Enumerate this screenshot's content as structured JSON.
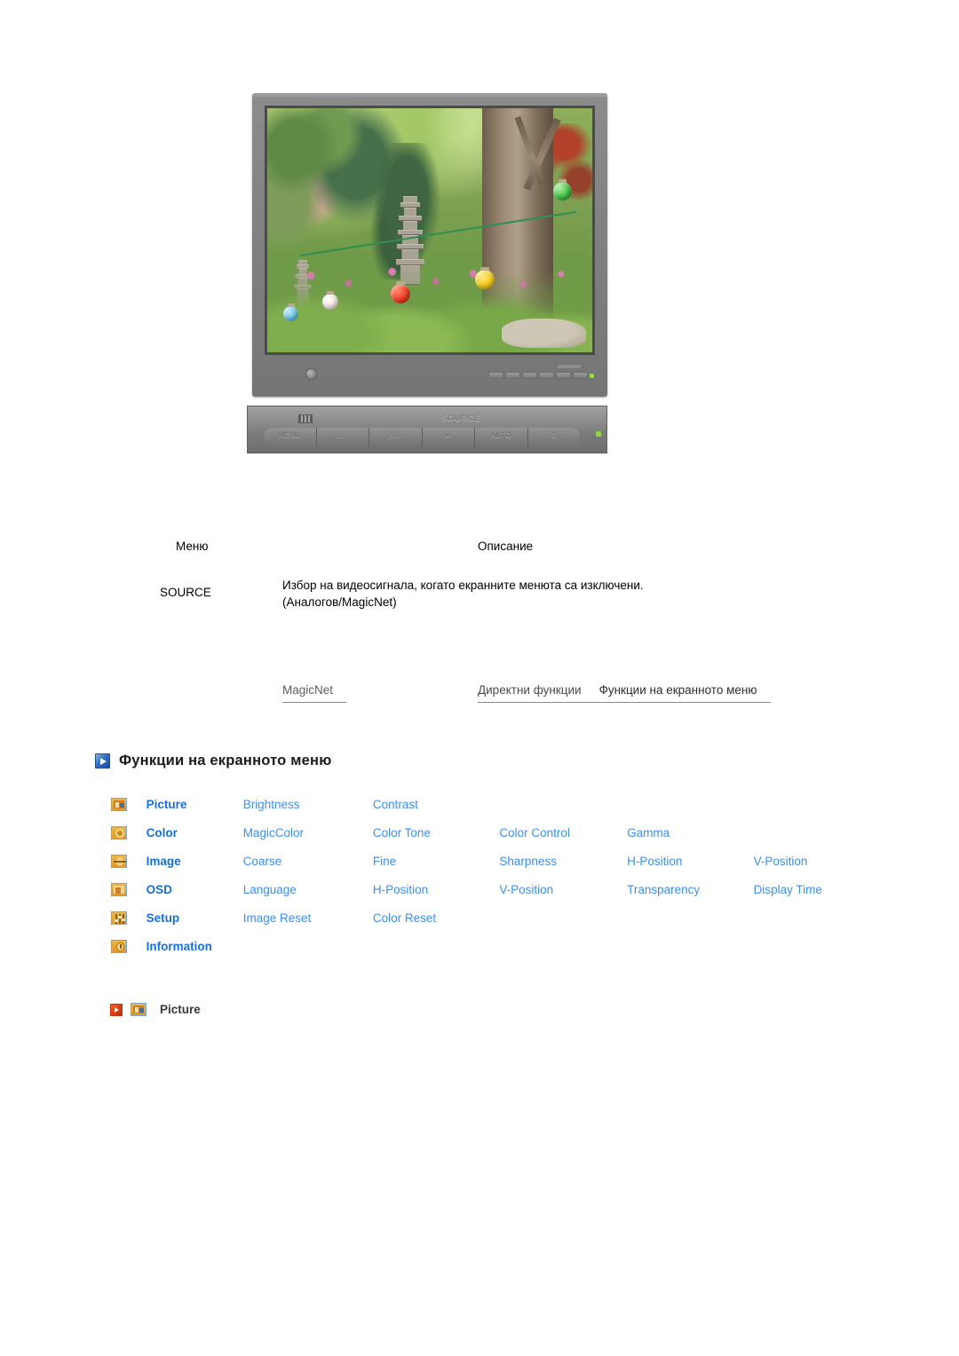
{
  "product_illustration": {
    "alt": "Samsung LCD monitor front view with garden photo on screen and close-up of front control panel",
    "panel_buttons": [
      {
        "label": "MENU",
        "name": "menu-button"
      },
      {
        "label": "…",
        "name": "down-up-button"
      },
      {
        "label": "△/☼",
        "name": "brightness-button"
      },
      {
        "label": "↵",
        "name": "enter-button"
      },
      {
        "label": "AUTO",
        "name": "auto-button"
      },
      {
        "label": "⏻",
        "name": "power-button"
      }
    ],
    "panel_source_label": "SOURCE"
  },
  "description_table": {
    "header_menu": "Меню",
    "header_description": "Описание",
    "rows": [
      {
        "key": "SOURCE",
        "value": "Избор на видеосигнала, когато екранните менюта са изключени.\n(Аналогов/MagicNet)"
      }
    ]
  },
  "tabs": {
    "left": "MagicNet",
    "right": [
      {
        "label": "Директни функции",
        "active": false
      },
      {
        "label": "Функции на екранното меню",
        "active": true
      }
    ]
  },
  "osd_section": {
    "heading": "Функции на екранното меню",
    "heading_icon": "blue-play-arrow-icon",
    "rows": [
      {
        "icon": "picture-icon",
        "name": "Picture",
        "items": [
          "Brightness",
          "Contrast",
          "",
          "",
          ""
        ]
      },
      {
        "icon": "color-icon",
        "name": "Color",
        "items": [
          "MagicColor",
          "Color Tone",
          "Color Control",
          "Gamma",
          ""
        ]
      },
      {
        "icon": "image-icon",
        "name": "Image",
        "items": [
          "Coarse",
          "Fine",
          "Sharpness",
          "H-Position",
          "V-Position"
        ]
      },
      {
        "icon": "osd-icon",
        "name": "OSD",
        "items": [
          "Language",
          "H-Position",
          "V-Position",
          "Transparency",
          "Display Time"
        ]
      },
      {
        "icon": "setup-icon",
        "name": "Setup",
        "items": [
          "Image Reset",
          "Color Reset",
          "",
          "",
          ""
        ]
      },
      {
        "icon": "information-icon",
        "name": "Information",
        "items": [
          "",
          "",
          "",
          "",
          ""
        ]
      }
    ]
  },
  "picture_subsection": {
    "arrow_icon": "red-play-arrow-icon",
    "menu_icon": "picture-icon",
    "label": "Picture"
  },
  "colors": {
    "menu_name": "#1a6fe0",
    "menu_sub": "#3d8ef5",
    "heading": "#1a1a1a",
    "icon_fill": "#e8a32e",
    "icon_border": "#79a6d2",
    "tab_underline": "#8b8b8b",
    "red_accent": "#e03d12"
  }
}
